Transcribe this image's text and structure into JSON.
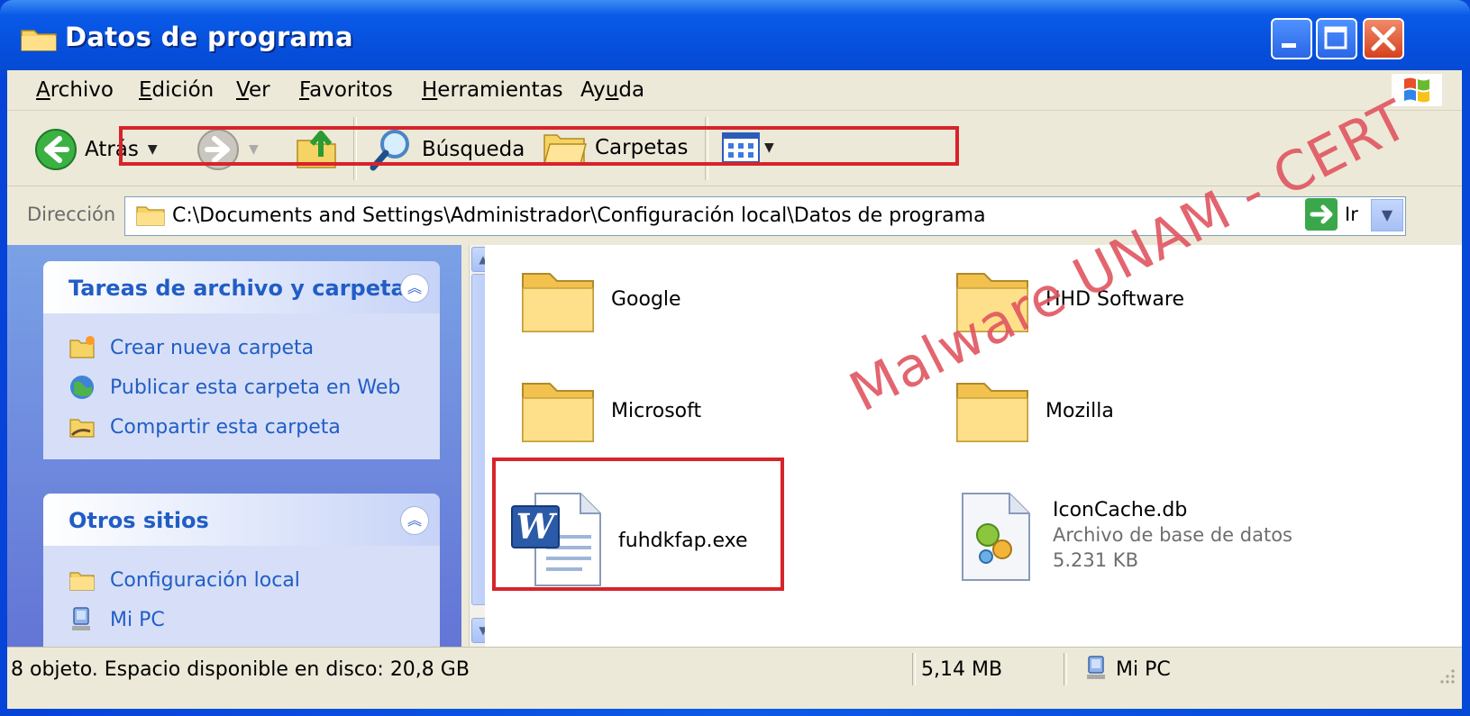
{
  "window": {
    "title": "Datos de programa"
  },
  "menu": {
    "items": [
      {
        "pre": "",
        "ul": "A",
        "post": "rchivo"
      },
      {
        "pre": "",
        "ul": "E",
        "post": "dición"
      },
      {
        "pre": "",
        "ul": "V",
        "post": "er"
      },
      {
        "pre": "",
        "ul": "F",
        "post": "avoritos"
      },
      {
        "pre": "",
        "ul": "H",
        "post": "erramientas"
      },
      {
        "pre": "Ay",
        "ul": "u",
        "post": "da"
      }
    ]
  },
  "toolbar": {
    "back_label": "Atrás",
    "search_label": "Búsqueda",
    "folders_label": "Carpetas"
  },
  "address": {
    "label": "Dirección",
    "path": "C:\\Documents and Settings\\Administrador\\Configuración local\\Datos de programa",
    "go_label": "Ir"
  },
  "tasks_panel": {
    "title": "Tareas de archivo y carpeta",
    "items": [
      {
        "label": "Crear nueva carpeta",
        "icon": "new-folder-icon"
      },
      {
        "label": "Publicar esta carpeta en Web",
        "icon": "publish-web-icon"
      },
      {
        "label": "Compartir esta carpeta",
        "icon": "share-folder-icon"
      }
    ]
  },
  "places_panel": {
    "title": "Otros sitios",
    "items": [
      {
        "label": "Configuración local",
        "icon": "folder-icon"
      },
      {
        "label": "Mi PC",
        "icon": "my-computer-icon"
      }
    ]
  },
  "files": [
    {
      "name": "Google",
      "type": "folder"
    },
    {
      "name": "HHD Software",
      "type": "folder"
    },
    {
      "name": "Microsoft",
      "type": "folder"
    },
    {
      "name": "Mozilla",
      "type": "folder"
    },
    {
      "name": "fuhdkfap.exe",
      "type": "word-document"
    },
    {
      "name": "IconCache.db",
      "type": "database",
      "description": "Archivo de base de datos",
      "size": "5.231 KB"
    }
  ],
  "watermark": "Malware UNAM - CERT",
  "status": {
    "objects": "8 objeto. Espacio disponible en disco: 20,8 GB",
    "size": "5,14 MB",
    "location": "Mi PC"
  },
  "colors": {
    "titlebar": "#0650dd",
    "highlight_frame": "#d8232a",
    "task_link": "#215dc6",
    "watermark": "#e05560"
  }
}
